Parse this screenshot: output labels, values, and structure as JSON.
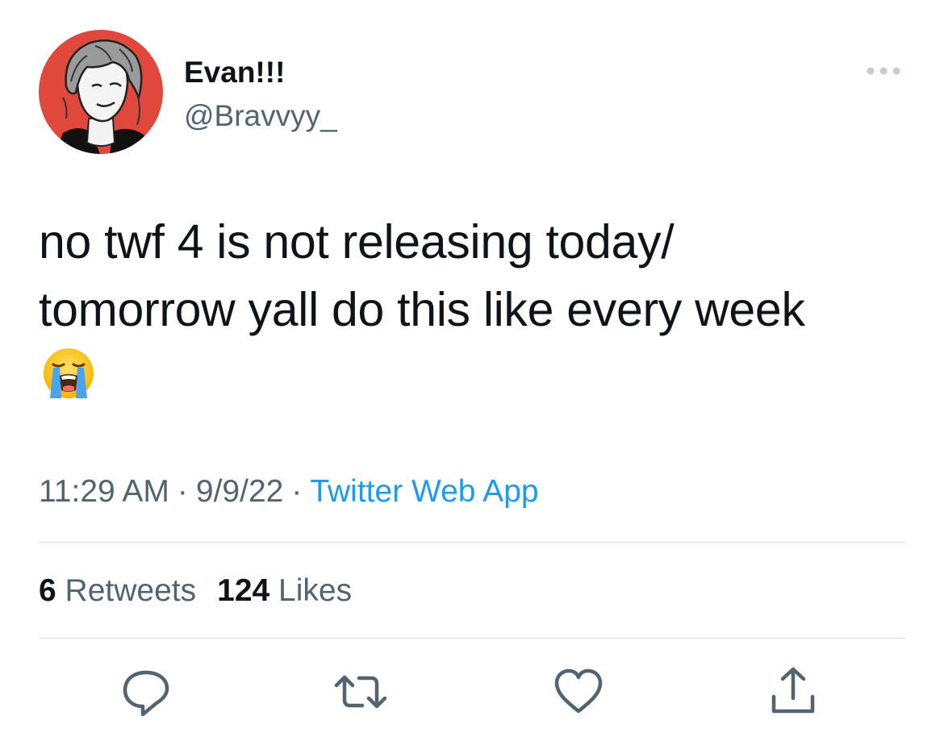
{
  "author": {
    "display_name": "Evan!!!",
    "handle": "@Bravvyy_",
    "avatar_icon": "cartoon-avatar-icon",
    "avatar_bg": "#e0483b"
  },
  "more_icon": "more-dots-icon",
  "tweet": {
    "lines": [
      "no twf 4 is not releasing today/",
      "tomorrow yall do this  like every week"
    ],
    "emoji": "loudly-crying-face-emoji"
  },
  "meta": {
    "time": "11:29 AM",
    "separator": "·",
    "date": "9/9/22",
    "source": "Twitter Web App"
  },
  "stats": {
    "retweets_count": "6",
    "retweets_label": "Retweets",
    "likes_count": "124",
    "likes_label": "Likes"
  },
  "actions": [
    {
      "icon": "reply-icon"
    },
    {
      "icon": "retweet-icon"
    },
    {
      "icon": "like-heart-icon"
    },
    {
      "icon": "share-icon"
    }
  ],
  "colors": {
    "text": "#0f1419",
    "secondary": "#536471",
    "link": "#1d9bf0",
    "divider": "#d8dde1"
  }
}
